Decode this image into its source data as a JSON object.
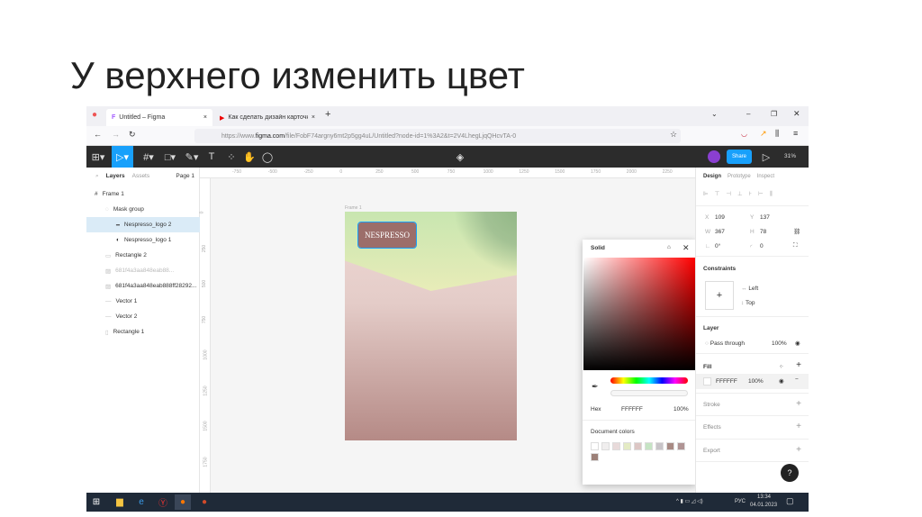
{
  "slide": {
    "title": "У верхнего изменить цвет"
  },
  "browser": {
    "tabs": [
      {
        "label": "Untitled – Figma",
        "close": "×"
      },
      {
        "label": "Как сделать дизайн карточки",
        "close": "×"
      }
    ],
    "new_tab": "+",
    "url_prefix": "https://www.",
    "url_domain": "figma.com",
    "url_rest": "/file/FobF74argny6mt2p5gg4uL/Untitled?node-id=1%3A2&t=2V4LhegLjqQHcvTA-0"
  },
  "toolbar": {
    "share_label": "Share",
    "zoom": "31%"
  },
  "left_panel": {
    "tabs": [
      "Layers",
      "Assets"
    ],
    "page": "Page 1",
    "layers": [
      {
        "name": "Frame 1",
        "icon": "frame-icon"
      },
      {
        "name": "Mask group",
        "icon": "mask-icon"
      },
      {
        "name": "Nespresso_logo 2",
        "icon": "line-icon",
        "selected": true
      },
      {
        "name": "Nespresso_logo 1",
        "icon": "image-icon"
      },
      {
        "name": "Rectangle 2",
        "icon": "rect-icon"
      },
      {
        "name": "681f4a3aa848eab88...",
        "icon": "image-icon",
        "hidden": true
      },
      {
        "name": "681f4a3aa848eab888ff28292...",
        "icon": "image-icon"
      },
      {
        "name": "Vector 1",
        "icon": "vector-icon"
      },
      {
        "name": "Vector 2",
        "icon": "vector-icon"
      },
      {
        "name": "Rectangle 1",
        "icon": "rect-icon"
      }
    ]
  },
  "canvas": {
    "ruler_x": [
      "-750",
      "-500",
      "-250",
      "0",
      "250",
      "500",
      "750",
      "1000",
      "1250",
      "1500",
      "1750",
      "2000",
      "2250"
    ],
    "ruler_y": [
      "0",
      "250",
      "500",
      "750",
      "1000",
      "1250",
      "1500",
      "1750"
    ],
    "frame_label": "Frame 1",
    "logo_text": "NESPRESSO"
  },
  "color_picker": {
    "mode": "Solid",
    "format": "Hex",
    "hex": "FFFFFF",
    "opacity": "100%",
    "doc_colors_label": "Document colors",
    "doc_colors": [
      "#ffffff",
      "#f0eeee",
      "#e8dada",
      "#e4ebc4",
      "#dcc6c4",
      "#c6e4c4",
      "#c8c4c8",
      "#a88a84",
      "#b09494",
      "#9c8078"
    ]
  },
  "right_panel": {
    "tabs": [
      "Design",
      "Prototype",
      "Inspect"
    ],
    "x": "109",
    "y": "137",
    "w": "367",
    "h": "78",
    "rotation": "0°",
    "radius": "0",
    "constraints_label": "Constraints",
    "constraint_h": "Left",
    "constraint_v": "Top",
    "layer_label": "Layer",
    "blend": "Pass through",
    "layer_opacity": "100%",
    "fill_label": "Fill",
    "fill_hex": "FFFFFF",
    "fill_opacity": "100%",
    "stroke_label": "Stroke",
    "effects_label": "Effects",
    "export_label": "Export",
    "help": "?"
  },
  "taskbar": {
    "lang": "РУС",
    "time": "13:34",
    "date": "04.01.2023"
  }
}
